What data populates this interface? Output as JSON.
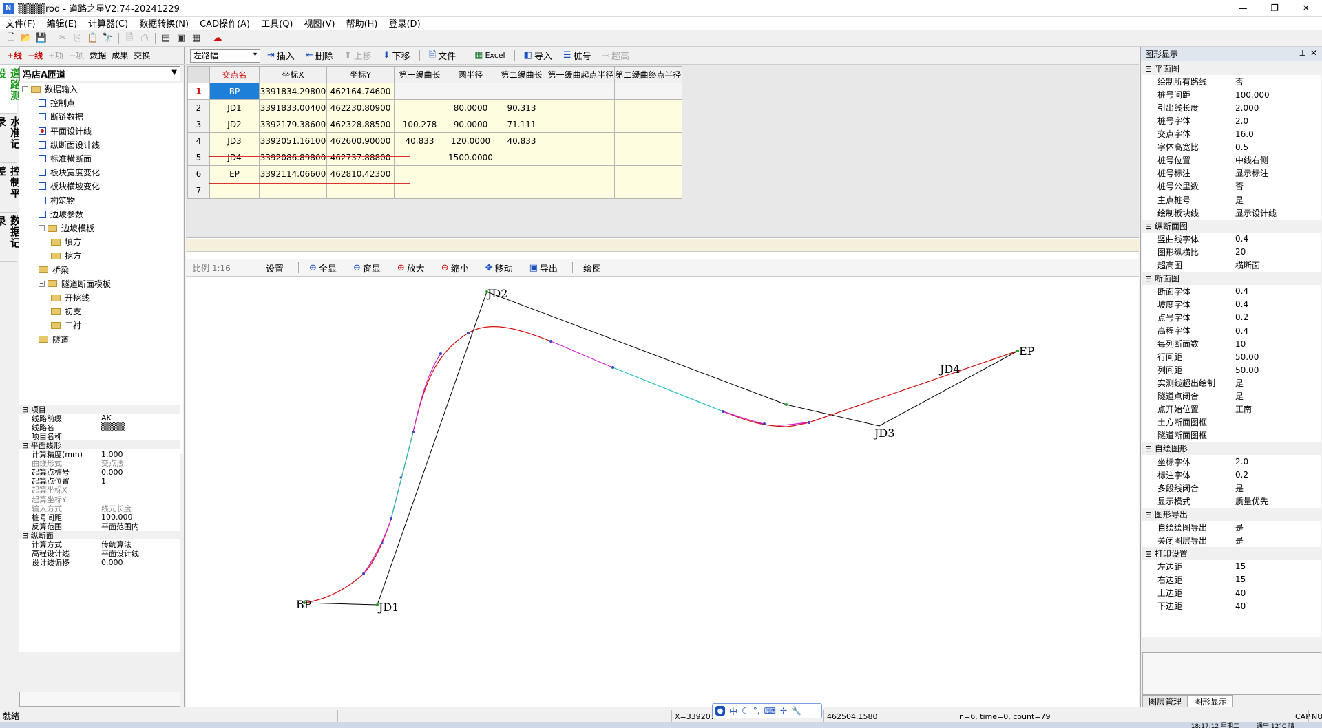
{
  "window": {
    "title": "▒▒▒▒rod - 道路之星V2.74-20241229",
    "icon_name": "app-icon"
  },
  "menu": [
    "文件(F)",
    "编辑(E)",
    "计算器(C)",
    "数据转换(N)",
    "CAD操作(A)",
    "工具(Q)",
    "视图(V)",
    "帮助(H)",
    "登录(D)"
  ],
  "toolbar_icons": [
    "new-file-icon",
    "open-folder-icon",
    "save-icon",
    "cut-icon",
    "copy-icon",
    "paste-icon",
    "find-icon",
    "print-preview-icon",
    "print-icon",
    "layout1-icon",
    "layout2-icon",
    "layout3-icon",
    "cloud-icon"
  ],
  "left": {
    "toolbar": {
      "add_line": "+线",
      "del_line": "−线",
      "add_item": "+项",
      "del_item": "−项",
      "data": "数据",
      "result": "成果",
      "exchange": "交换"
    },
    "vtabs": [
      "道路测设",
      "水准记录",
      "控制平差",
      "数据记录"
    ],
    "combo": "冯店A匝道",
    "tree": [
      {
        "label": "数据输入",
        "kind": "folder",
        "level": 0,
        "pm": "−"
      },
      {
        "label": "控制点",
        "kind": "chk",
        "level": 1
      },
      {
        "label": "断链数据",
        "kind": "chk",
        "level": 1
      },
      {
        "label": "平面设计线",
        "kind": "chk",
        "level": 1,
        "on": true
      },
      {
        "label": "纵断面设计线",
        "kind": "chk",
        "level": 1
      },
      {
        "label": "标准横断面",
        "kind": "chk",
        "level": 1
      },
      {
        "label": "板块宽度变化",
        "kind": "chk",
        "level": 1
      },
      {
        "label": "板块横坡变化",
        "kind": "chk",
        "level": 1
      },
      {
        "label": "构筑物",
        "kind": "chk",
        "level": 1
      },
      {
        "label": "边坡参数",
        "kind": "chk",
        "level": 1
      },
      {
        "label": "边坡模板",
        "kind": "folder",
        "level": 1,
        "pm": "−"
      },
      {
        "label": "填方",
        "kind": "folder",
        "level": 2
      },
      {
        "label": "挖方",
        "kind": "folder",
        "level": 2
      },
      {
        "label": "桥梁",
        "kind": "folder",
        "level": 1
      },
      {
        "label": "隧道断面模板",
        "kind": "folder",
        "level": 1,
        "pm": "−"
      },
      {
        "label": "开挖线",
        "kind": "folder",
        "level": 2
      },
      {
        "label": "初支",
        "kind": "folder",
        "level": 2
      },
      {
        "label": "二衬",
        "kind": "folder",
        "level": 2
      },
      {
        "label": "隧道",
        "kind": "folder",
        "level": 1
      }
    ],
    "props": [
      {
        "k": "项目",
        "cat": true
      },
      {
        "k": "线路前缀",
        "v": "AK"
      },
      {
        "k": "线路名",
        "v": "▒▒▒▒"
      },
      {
        "k": "项目名称",
        "v": ""
      },
      {
        "k": "平面线形",
        "cat": true
      },
      {
        "k": "计算精度(mm)",
        "v": "  1.000"
      },
      {
        "k": "曲线形式",
        "v": "交点法",
        "dim": true
      },
      {
        "k": "起算点桩号",
        "v": "    0.000"
      },
      {
        "k": "起算点位置",
        "v": "1"
      },
      {
        "k": "起算坐标X",
        "v": "",
        "dim": true
      },
      {
        "k": "起算坐标Y",
        "v": "",
        "dim": true
      },
      {
        "k": "输入方式",
        "v": "线元长度",
        "dim": true
      },
      {
        "k": "桩号间距",
        "v": "100.000"
      },
      {
        "k": "反算范围",
        "v": "平面范围内"
      },
      {
        "k": "纵断面",
        "cat": true
      },
      {
        "k": "计算方式",
        "v": "传统算法"
      },
      {
        "k": "高程设计线",
        "v": "平面设计线"
      },
      {
        "k": "设计线偏移",
        "v": "  0.000"
      }
    ]
  },
  "grid_toolbar": {
    "combo": "左路幅",
    "buttons": [
      {
        "label": "插入",
        "icon": "insert-icon"
      },
      {
        "label": "删除",
        "icon": "delete-icon"
      },
      {
        "label": "上移",
        "icon": "up-arrow-icon",
        "dis": true
      },
      {
        "label": "下移",
        "icon": "down-arrow-icon"
      },
      {
        "label": "文件",
        "icon": "file-icon"
      },
      {
        "label": "Excel",
        "icon": "excel-icon"
      },
      {
        "label": "导入",
        "icon": "import-icon"
      },
      {
        "label": "桩号",
        "icon": "list-icon"
      },
      {
        "label": "超高",
        "icon": "superelevation-icon",
        "dis": true
      }
    ]
  },
  "table": {
    "headers": [
      "交点名",
      "坐标X",
      "坐标Y",
      "第一缓曲长",
      "圆半径",
      "第二缓曲长",
      "第一缓曲起点半径",
      "第二缓曲终点半径"
    ],
    "rows": [
      [
        "BP",
        "3391834.29800",
        "462164.74600",
        "",
        "",
        "",
        "",
        ""
      ],
      [
        "JD1",
        "3391833.00400",
        "462230.80900",
        "",
        "80.0000",
        "90.313",
        "",
        ""
      ],
      [
        "JD2",
        "3392179.38600",
        "462328.88500",
        "100.278",
        "90.0000",
        "71.111",
        "",
        ""
      ],
      [
        "JD3",
        "3392051.16100",
        "462600.90000",
        "40.833",
        "120.0000",
        "40.833",
        "",
        ""
      ],
      [
        "JD4",
        "3392086.89800",
        "462737.88800",
        "",
        "1500.0000",
        "",
        "",
        ""
      ],
      [
        "EP",
        "3392114.06600",
        "462810.42300",
        "",
        "",
        "",
        "",
        ""
      ],
      [
        "",
        "",
        "",
        "",
        "",
        "",
        "",
        ""
      ]
    ]
  },
  "draw_toolbar": {
    "scale": "比例 1:16",
    "buttons": [
      {
        "label": "设置",
        "icon": ""
      },
      {
        "label": "全显",
        "icon": "zoom-all-icon"
      },
      {
        "label": "窗显",
        "icon": "zoom-window-icon"
      },
      {
        "label": "放大",
        "icon": "zoom-in-icon"
      },
      {
        "label": "缩小",
        "icon": "zoom-out-icon"
      },
      {
        "label": "移动",
        "icon": "pan-icon"
      },
      {
        "label": "导出",
        "icon": "export-icon"
      },
      {
        "label": "绘图",
        "icon": ""
      }
    ]
  },
  "canvas_labels": {
    "bp": "BP",
    "jd1": "JD1",
    "jd2": "JD2",
    "jd3": "JD3",
    "jd4": "JD4",
    "ep": "EP"
  },
  "right": {
    "title": "图形显示",
    "props": [
      {
        "k": "平面图",
        "cat": true
      },
      {
        "k": "绘制所有路线",
        "v": "否"
      },
      {
        "k": "桩号间距",
        "v": "100.000"
      },
      {
        "k": "引出线长度",
        "v": "2.000"
      },
      {
        "k": "桩号字体",
        "v": "2.0"
      },
      {
        "k": "交点字体",
        "v": "16.0"
      },
      {
        "k": "字体高宽比",
        "v": "0.5"
      },
      {
        "k": "桩号位置",
        "v": "中线右侧"
      },
      {
        "k": "桩号标注",
        "v": "显示标注"
      },
      {
        "k": "桩号公里数",
        "v": "否"
      },
      {
        "k": "主点桩号",
        "v": "是"
      },
      {
        "k": "绘制板块线",
        "v": "显示设计线"
      },
      {
        "k": "纵断面图",
        "cat": true
      },
      {
        "k": "竖曲线字体",
        "v": "0.4"
      },
      {
        "k": "图形纵横比",
        "v": "20"
      },
      {
        "k": "超高图",
        "v": "横断面"
      },
      {
        "k": "断面图",
        "cat": true
      },
      {
        "k": "断面字体",
        "v": "0.4"
      },
      {
        "k": "坡度字体",
        "v": "0.4"
      },
      {
        "k": "点号字体",
        "v": "0.2"
      },
      {
        "k": "高程字体",
        "v": "0.4"
      },
      {
        "k": "每列断面数",
        "v": "10"
      },
      {
        "k": "行间距",
        "v": "50.00"
      },
      {
        "k": "列间距",
        "v": "50.00"
      },
      {
        "k": "实测线超出绘制",
        "v": "是"
      },
      {
        "k": "隧道点闭合",
        "v": "是"
      },
      {
        "k": "点开始位置",
        "v": "正南"
      },
      {
        "k": "土方断面图框",
        "v": ""
      },
      {
        "k": "隧道断面图框",
        "v": ""
      },
      {
        "k": "自绘图形",
        "cat": true
      },
      {
        "k": "坐标字体",
        "v": "2.0"
      },
      {
        "k": "标注字体",
        "v": "0.2"
      },
      {
        "k": "多段线闭合",
        "v": "是"
      },
      {
        "k": "显示模式",
        "v": "质量优先"
      },
      {
        "k": "图形导出",
        "cat": true
      },
      {
        "k": "自绘绘图导出",
        "v": "是"
      },
      {
        "k": "关闭图层导出",
        "v": "是"
      },
      {
        "k": "打印设置",
        "cat": true
      },
      {
        "k": "左边距",
        "v": "15"
      },
      {
        "k": "右边距",
        "v": "15"
      },
      {
        "k": "上边距",
        "v": "40"
      },
      {
        "k": "下边距",
        "v": "40"
      }
    ],
    "tabs": [
      "图层管理",
      "图形显示"
    ]
  },
  "status": {
    "ready": "就绪",
    "coord_x": "X=339207",
    "coord_y": "462504.1580",
    "info": "n=6, time=0, count=79",
    "time": "18:17:12 星期二",
    "weather": "通宁 12°C 晴",
    "caps": "CAP",
    "num": "NU"
  },
  "ime": [
    "中",
    "☾",
    "°,",
    "⌨",
    "✢",
    "🔧"
  ]
}
